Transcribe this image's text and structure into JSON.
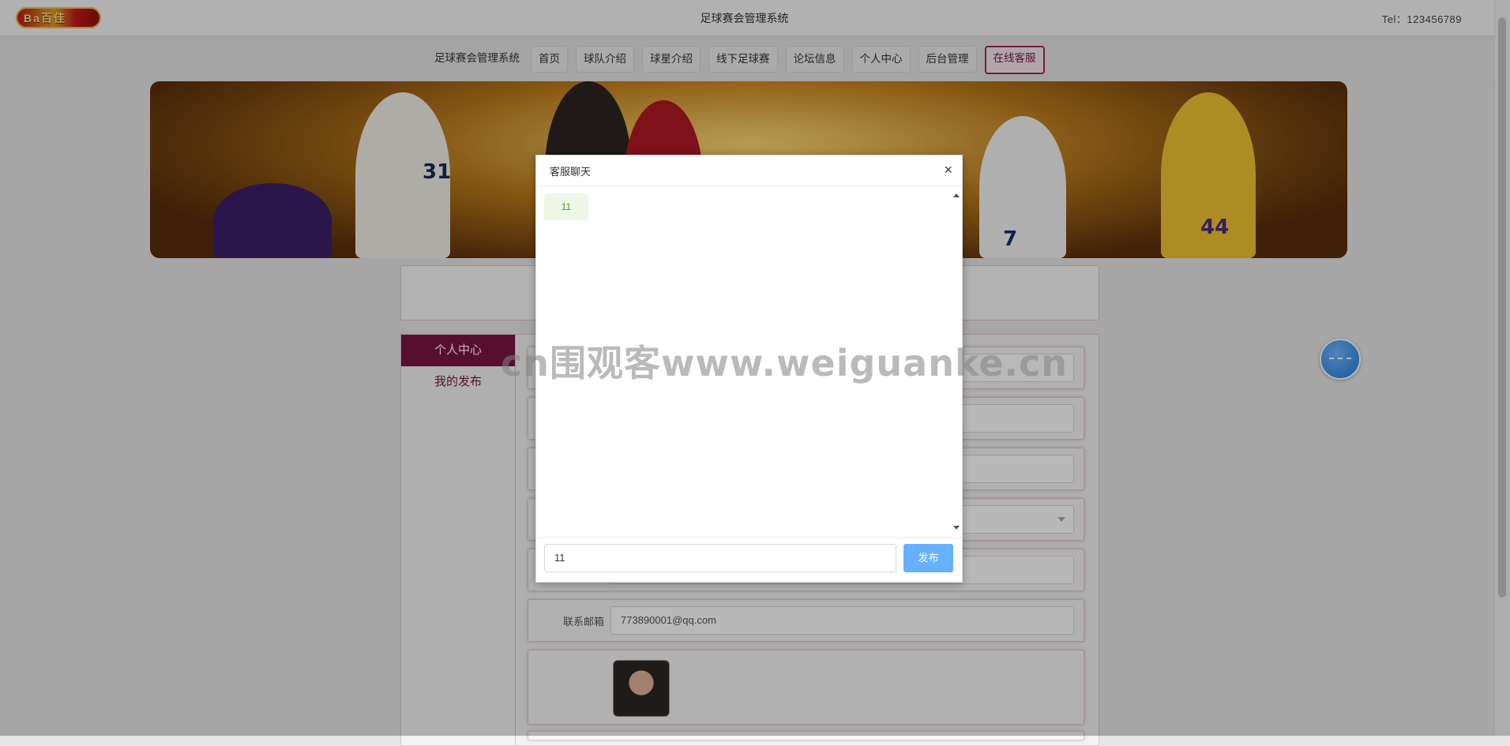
{
  "header": {
    "logo_text": "Ba百佳",
    "site_title": "足球赛会管理系统",
    "tel": "Tel：123456789"
  },
  "nav": {
    "items": [
      "足球赛会管理系统",
      "首页",
      "球队介绍",
      "球星介绍",
      "线下足球赛",
      "论坛信息",
      "个人中心",
      "后台管理",
      "在线客服"
    ],
    "active_index": 8
  },
  "banner": {
    "jersey_numbers": [
      "31",
      "7",
      "44"
    ]
  },
  "sidebar": {
    "items": [
      {
        "label": "个人中心",
        "active": true
      },
      {
        "label": "我的发布",
        "active": false
      }
    ]
  },
  "form": {
    "email_label": "联系邮箱",
    "email_value": "773890001@qq.com"
  },
  "dialog": {
    "title": "客服聊天",
    "close_symbol": "×",
    "messages": [
      "11"
    ],
    "input_value": "11",
    "send_label": "发布"
  },
  "watermark": "cn围观客www.weiguanke.cn"
}
